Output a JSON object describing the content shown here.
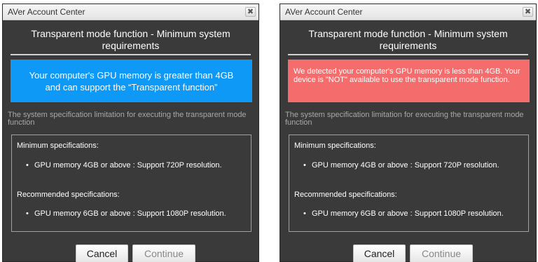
{
  "dialogs": [
    {
      "title": "AVer Account Center",
      "close_glyph": "✖",
      "heading": "Transparent mode function - Minimum system requirements",
      "banner_text": "Your computer's GPU memory is greater than 4GB and can support the “Transparent function”",
      "banner_color": "#0d99f5",
      "spec_note": "The system specification limitation for executing the transparent mode function",
      "min_heading": "Minimum specifications:",
      "min_item": "GPU memory 4GB or above : Support 720P resolution.",
      "rec_heading": "Recommended specifications:",
      "rec_item": "GPU memory 6GB or above : Support 1080P resolution.",
      "cancel_label": "Cancel",
      "continue_label": "Continue"
    },
    {
      "title": "AVer Account Center",
      "close_glyph": "✖",
      "heading": "Transparent mode function - Minimum system requirements",
      "banner_text": "We detected your computer's GPU memory is less than 4GB. Your device is \"NOT\" available to use the transparent mode function.",
      "banner_color": "#f46c6c",
      "spec_note": "The system specification limitation for executing the transparent mode function",
      "min_heading": "Minimum specifications:",
      "min_item": "GPU memory 4GB or above : Support 720P resolution.",
      "rec_heading": "Recommended specifications:",
      "rec_item": "GPU memory 6GB or above : Support 1080P resolution.",
      "cancel_label": "Cancel",
      "continue_label": "Continue"
    }
  ]
}
